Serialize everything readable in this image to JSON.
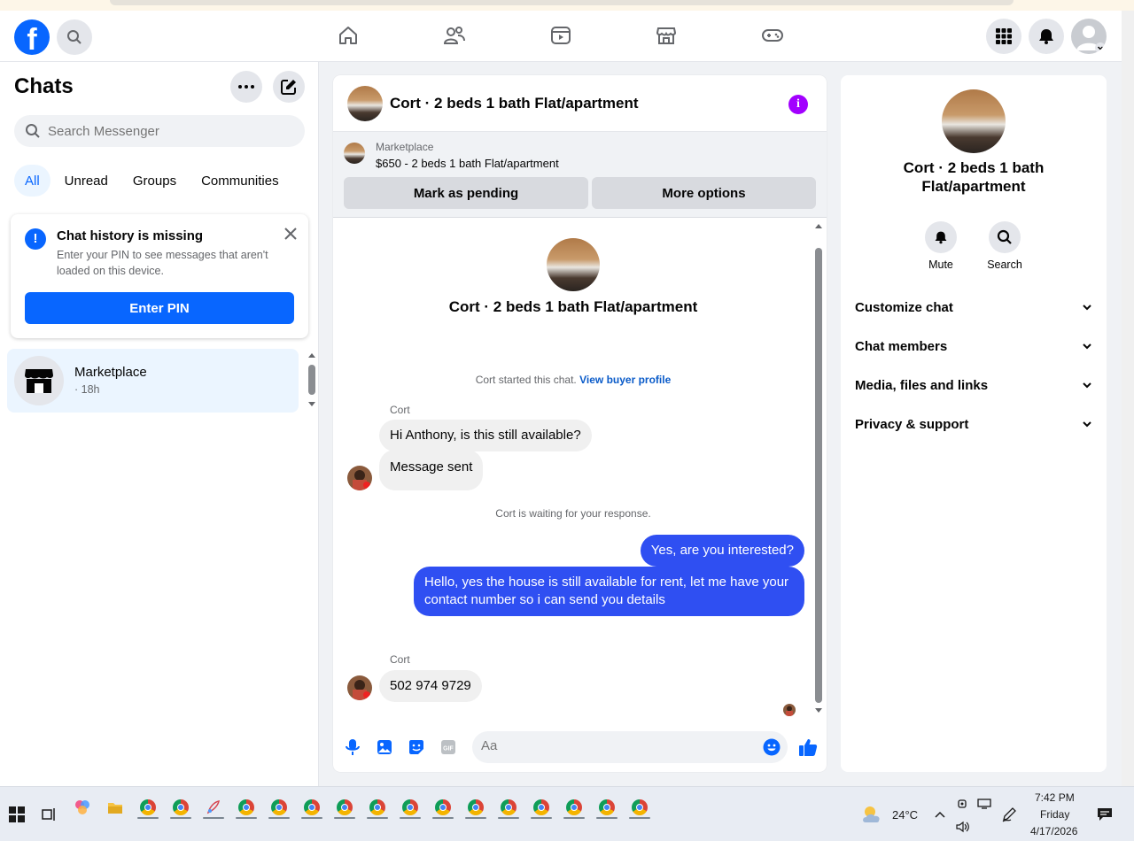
{
  "header": {
    "logo_letter": "f",
    "nav_icons": [
      "home-icon",
      "friends-icon",
      "video-icon",
      "marketplace-icon",
      "gaming-icon"
    ],
    "right_icons": [
      "menu-grid-icon",
      "bell-icon",
      "profile-avatar"
    ]
  },
  "sidebar": {
    "title": "Chats",
    "search_placeholder": "Search Messenger",
    "filters": [
      "All",
      "Unread",
      "Groups",
      "Communities"
    ],
    "notice": {
      "title": "Chat history is missing",
      "text": "Enter your PIN to see messages that aren't loaded on this device.",
      "button": "Enter PIN"
    },
    "chats": [
      {
        "name": "Marketplace",
        "time": "· 18h"
      }
    ]
  },
  "chat": {
    "title": "Cort · 2 beds 1 bath Flat/apartment",
    "marketplace_label": "Marketplace",
    "listing": "$650 - 2 beds 1 bath Flat/apartment",
    "btn_pending": "Mark as pending",
    "btn_more": "More options",
    "conv_name": "Cort · 2 beds 1 bath Flat/apartment",
    "started_text": "Cort started this chat.",
    "buyer_link": "View buyer profile",
    "sender1": "Cort",
    "msg1": "Hi Anthony, is this still available?",
    "msg2": "Message sent",
    "waiting": "Cort is waiting for your response.",
    "out1": "Yes, are you interested?",
    "out2": "Hello, yes the house is still available for rent, let me have your contact number so i can send you details",
    "sender2": "Cort",
    "msg3": "502 974 9729",
    "composer_placeholder": "Aa"
  },
  "info": {
    "name": "Cort · 2 beds 1 bath Flat/apartment",
    "mute": "Mute",
    "search": "Search",
    "sections": [
      "Customize chat",
      "Chat members",
      "Media, files and links",
      "Privacy & support"
    ]
  },
  "taskbar": {
    "weather": "24°C",
    "time": "7:42 PM",
    "day": "Friday",
    "date": "4/17/2026"
  },
  "colors": {
    "accent": "#0866ff",
    "outgoing_bubble": "#2f4ff2",
    "info_icon": "#a200ff"
  }
}
